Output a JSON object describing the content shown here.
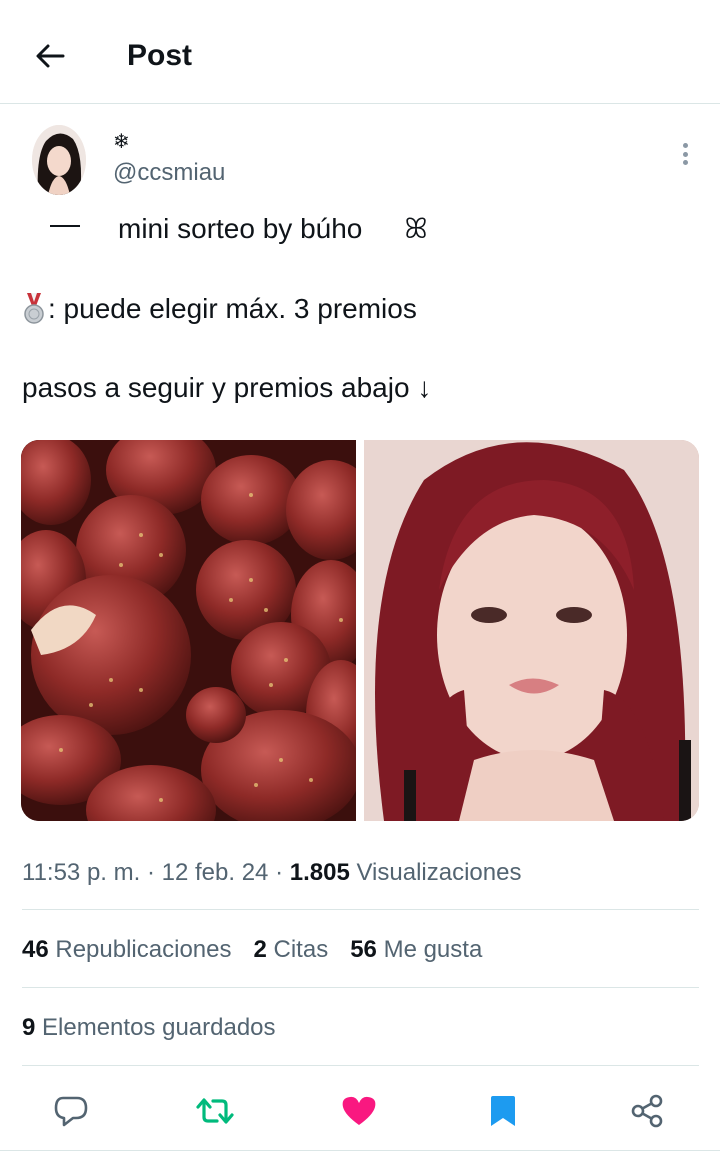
{
  "header": {
    "title": "Post",
    "back_icon": "arrow-left-icon"
  },
  "post": {
    "display_name": "❄",
    "handle": "@ccsmiau",
    "line1_text": "mini sorteo by búho",
    "line1_glyph": "ꕤ",
    "line2_text": ": puede elegir máx. 3 premios",
    "line3_text": "pasos a seguir y premios abajo ↓",
    "media": [
      {
        "name": "strawberries-photo"
      },
      {
        "name": "red-hair-portrait-photo"
      }
    ],
    "time": "11:53 p. m.",
    "date": "12 feb. 24",
    "views_count": "1.805",
    "views_label": "Visualizaciones",
    "separator": "·"
  },
  "stats": {
    "reposts_count": "46",
    "reposts_label": "Republicaciones",
    "quotes_count": "2",
    "quotes_label": "Citas",
    "likes_count": "56",
    "likes_label": "Me gusta",
    "bookmarks_count": "9",
    "bookmarks_label": "Elementos guardados"
  },
  "colors": {
    "text": "#0f1419",
    "muted": "#536471",
    "border": "#dbe6e6",
    "repost_green": "#00ba7c",
    "like_pink": "#f91880",
    "bookmark_blue": "#1d9bf0"
  },
  "actions": [
    {
      "name": "reply-icon"
    },
    {
      "name": "repost-icon",
      "state": "active"
    },
    {
      "name": "like-icon",
      "state": "active"
    },
    {
      "name": "bookmark-icon",
      "state": "active"
    },
    {
      "name": "share-icon"
    }
  ]
}
